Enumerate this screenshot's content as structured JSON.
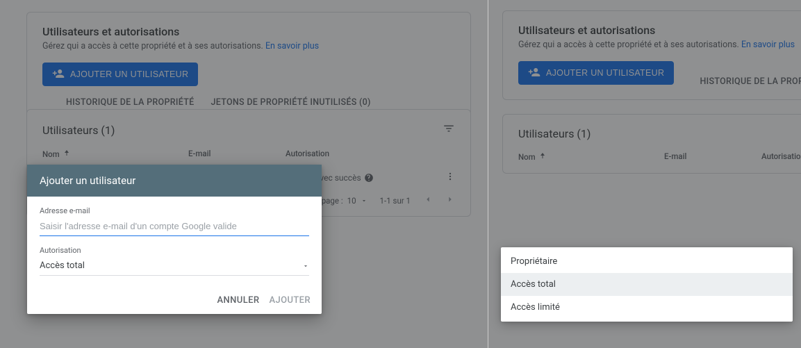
{
  "header": {
    "title": "Utilisateurs et autorisations",
    "subtitle": "Gérez qui a accès à cette propriété et à ses autorisations. ",
    "learn_more": "En savoir plus",
    "add_button": "AJOUTER UN UTILISATEUR",
    "link_history": "HISTORIQUE DE LA PROPRIÉTÉ",
    "link_tokens": "JETONS DE PROPRIÉTÉ INUTILISÉS (0)"
  },
  "users": {
    "title": "Utilisateurs (1)",
    "col_name": "Nom",
    "col_email": "E-mail",
    "col_auth": "Autorisation",
    "verification_text": "fectuée avec succès",
    "rows_per_page_label": "par page :",
    "rows_per_page_value": "10",
    "range": "1-1 sur 1"
  },
  "dialog": {
    "title": "Ajouter un utilisateur",
    "email_label": "Adresse e-mail",
    "email_placeholder": "Saisir l'adresse e-mail d'un compte Google valide",
    "auth_label": "Autorisation",
    "auth_value": "Accès total",
    "cancel": "ANNULER",
    "confirm": "AJOUTER"
  },
  "dropdown": {
    "options": [
      {
        "label": "Propriétaire",
        "selected": false
      },
      {
        "label": "Accès total",
        "selected": true
      },
      {
        "label": "Accès limité",
        "selected": false
      }
    ]
  }
}
